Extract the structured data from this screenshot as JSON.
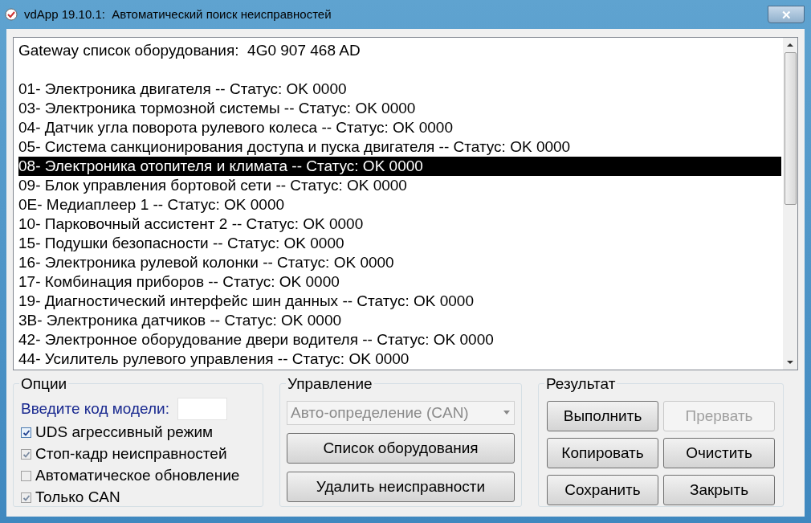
{
  "window": {
    "title": "vdApp 19.10.1:  Автоматический поиск неисправностей",
    "close": "✕"
  },
  "list": {
    "header": "Gateway список оборудования:  4G0 907 468 AD",
    "rows": [
      {
        "text": "01- Электроника двигателя -- Статус: OK 0000",
        "selected": false
      },
      {
        "text": "03- Электроника тормозной системы -- Статус: OK 0000",
        "selected": false
      },
      {
        "text": "04- Датчик угла поворота рулевого колеса -- Статус: OK 0000",
        "selected": false
      },
      {
        "text": "05- Система санкционирования доступа и пуска двигателя -- Статус: OK 0000",
        "selected": false
      },
      {
        "text": "08- Электроника отопителя и климата -- Статус: OK 0000",
        "selected": true
      },
      {
        "text": "09- Блок управления бортовой сети -- Статус: OK 0000",
        "selected": false
      },
      {
        "text": "0E- Медиаплеер 1 -- Статус: OK 0000",
        "selected": false
      },
      {
        "text": "10- Парковочный ассистент 2 -- Статус: OK 0000",
        "selected": false
      },
      {
        "text": "15- Подушки безопасности -- Статус: OK 0000",
        "selected": false
      },
      {
        "text": "16- Электроника рулевой колонки -- Статус: OK 0000",
        "selected": false
      },
      {
        "text": "17- Комбинация приборов -- Статус: OK 0000",
        "selected": false
      },
      {
        "text": "19- Диагностический интерфейс шин данных -- Статус: OK 0000",
        "selected": false
      },
      {
        "text": "3B- Электроника датчиков -- Статус: OK 0000",
        "selected": false
      },
      {
        "text": "42- Электронное оборудование двери водителя -- Статус: OK 0000",
        "selected": false
      },
      {
        "text": "44- Усилитель рулевого управления -- Статус: OK 0000",
        "selected": false
      }
    ]
  },
  "options": {
    "title": "Опции",
    "model_label": "Введите код модели:",
    "checkboxes": [
      {
        "label": "UDS агрессивный режим",
        "checked": true,
        "disabled": false
      },
      {
        "label": "Стоп-кадр неисправностей",
        "checked": true,
        "disabled": true
      },
      {
        "label": "Автоматическое обновление",
        "checked": false,
        "disabled": true
      },
      {
        "label": "Только CAN",
        "checked": true,
        "disabled": true
      }
    ]
  },
  "control": {
    "title": "Управление",
    "dropdown": {
      "value": "Авто-определение (CAN)",
      "disabled": true
    },
    "buttons": [
      {
        "label": "Список оборудования",
        "disabled": false
      },
      {
        "label": "Удалить неисправности",
        "disabled": false
      }
    ]
  },
  "result": {
    "title": "Результат",
    "buttons": [
      {
        "label": "Выполнить",
        "disabled": false
      },
      {
        "label": "Прервать",
        "disabled": true
      },
      {
        "label": "Копировать",
        "disabled": false
      },
      {
        "label": "Очистить",
        "disabled": false
      },
      {
        "label": "Сохранить",
        "disabled": false
      },
      {
        "label": "Закрыть",
        "disabled": false
      }
    ]
  }
}
